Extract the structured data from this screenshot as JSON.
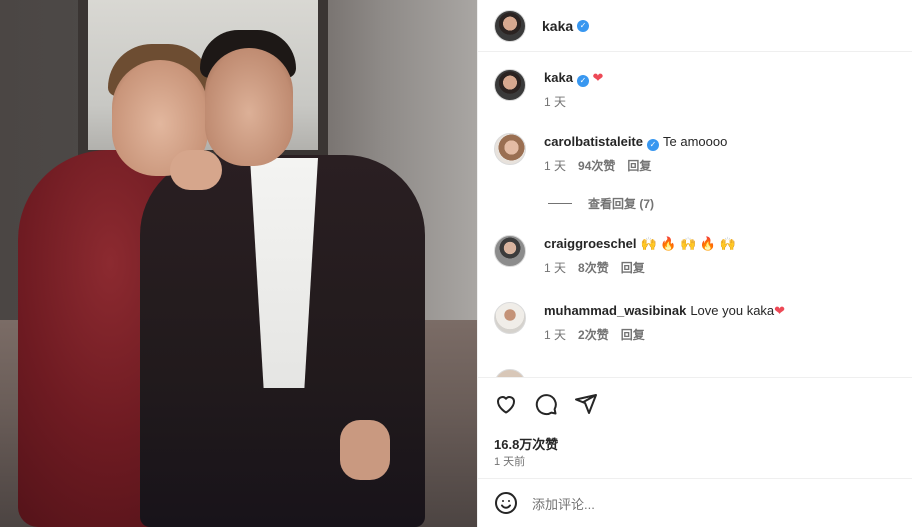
{
  "post": {
    "author": "kaka",
    "caption_heart": "❤",
    "caption_time": "1 天"
  },
  "comments": [
    {
      "user": "carolbatistaleite",
      "verified": true,
      "text": "Te amoooo",
      "time": "1 天",
      "likes": "94次赞",
      "reply": "回复",
      "view_replies": "查看回复 (7)"
    },
    {
      "user": "craiggroeschel",
      "verified": false,
      "text": "🙌 🔥 🙌 🔥 🙌",
      "time": "1 天",
      "likes": "8次赞",
      "reply": "回复"
    },
    {
      "user": "muhammad_wasibinak",
      "verified": false,
      "text": "Love you kaka",
      "heart": "❤",
      "time": "1 天",
      "likes": "2次赞",
      "reply": "回复"
    }
  ],
  "actions": {
    "like_icon": "heart-icon",
    "comment_icon": "comment-icon",
    "share_icon": "share-icon",
    "likes_count": "16.8万次赞",
    "post_time": "1 天前"
  },
  "add_comment": {
    "emoji_icon": "smile-icon",
    "placeholder": "添加评论..."
  },
  "colors": {
    "verified": "#3897f0",
    "heart": "#ed4956",
    "secondary_text": "#737373"
  }
}
